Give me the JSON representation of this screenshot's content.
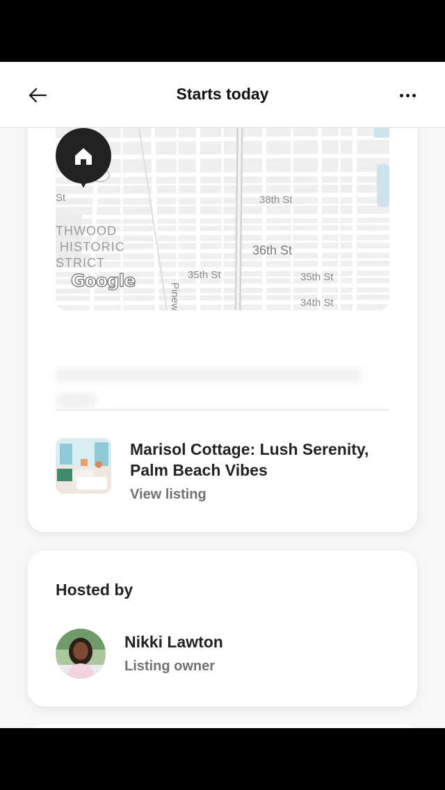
{
  "header": {
    "title": "Starts today",
    "back_icon": "arrow-left-icon",
    "more_icon": "more-horizontal-icon"
  },
  "map": {
    "streets": [
      "38th St",
      "36th St",
      "35th St",
      "35th St",
      "34th St",
      "Pinew"
    ],
    "district_lines": [
      "THWOOD",
      " HISTORIC",
      "STRICT"
    ],
    "partial_left_label": "St",
    "attribution": "Google",
    "pin_icon": "home-icon"
  },
  "listing": {
    "title": "Marisol Cottage: Lush Serenity, Palm Beach Vibes",
    "link": "View listing"
  },
  "host": {
    "section_label": "Hosted by",
    "name": "Nikki Lawton",
    "role": "Listing owner"
  },
  "colors": {
    "accent": "#222222",
    "muted": "#717171",
    "map_bg": "#efefef",
    "pin": "#222222"
  }
}
